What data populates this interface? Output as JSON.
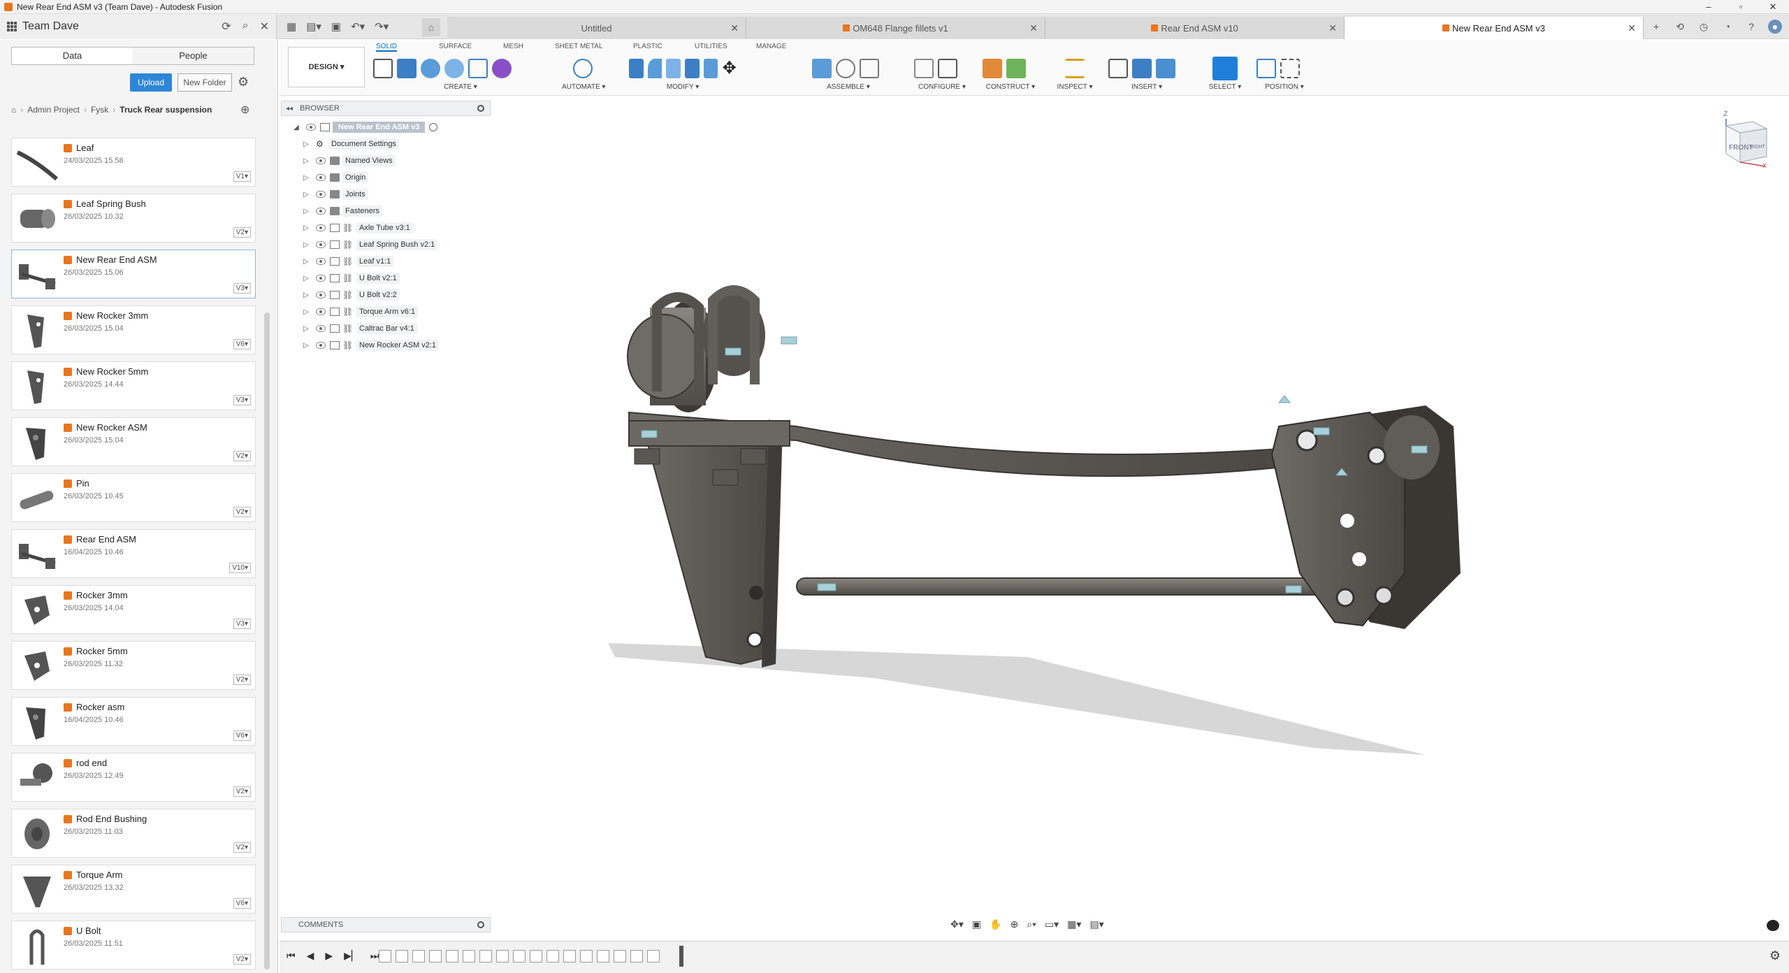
{
  "window": {
    "title": "New Rear End ASM v3 (Team Dave) - Autodesk Fusion",
    "minimize": "–",
    "maximize": "▫",
    "close": "✕"
  },
  "team": {
    "name": "Team Dave"
  },
  "tabs": [
    {
      "label": "Untitled",
      "active": false
    },
    {
      "label": "OM648 Flange fillets v1",
      "active": false
    },
    {
      "label": "Rear End ASM v10",
      "active": false
    },
    {
      "label": "New Rear End ASM v3",
      "active": true
    }
  ],
  "datapanel": {
    "tabs": [
      "Data",
      "People"
    ],
    "upload_label": "Upload",
    "new_folder_label": "New Folder",
    "breadcrumb": [
      "Admin Project",
      "Fysk",
      "Truck Rear suspension"
    ],
    "files": [
      {
        "name": "Leaf",
        "date": "24/03/2025 15.58",
        "version": "V1▾",
        "thumb": "leaf"
      },
      {
        "name": "Leaf Spring Bush",
        "date": "26/03/2025 10.32",
        "version": "V2▾",
        "thumb": "bush"
      },
      {
        "name": "New Rear End ASM",
        "date": "26/03/2025 15.06",
        "version": "V3▾",
        "thumb": "asm",
        "selected": true
      },
      {
        "name": "New Rocker 3mm",
        "date": "26/03/2025 15.04",
        "version": "V6▾",
        "thumb": "rocker"
      },
      {
        "name": "New Rocker 5mm",
        "date": "26/03/2025 14.44",
        "version": "V3▾",
        "thumb": "rocker"
      },
      {
        "name": "New Rocker ASM",
        "date": "26/03/2025 15.04",
        "version": "V2▾",
        "thumb": "rockerasm"
      },
      {
        "name": "Pin",
        "date": "26/03/2025 10.45",
        "version": "V2▾",
        "thumb": "pin"
      },
      {
        "name": "Rear End ASM",
        "date": "16/04/2025 10.46",
        "version": "V10▾",
        "thumb": "asm"
      },
      {
        "name": "Rocker 3mm",
        "date": "26/03/2025 14.04",
        "version": "V3▾",
        "thumb": "rocker2"
      },
      {
        "name": "Rocker 5mm",
        "date": "26/03/2025 11.32",
        "version": "V2▾",
        "thumb": "rocker2"
      },
      {
        "name": "Rocker asm",
        "date": "16/04/2025 10.46",
        "version": "V6▾",
        "thumb": "rockerasm"
      },
      {
        "name": "rod end",
        "date": "26/03/2025 12.49",
        "version": "V2▾",
        "thumb": "rodend"
      },
      {
        "name": "Rod End Bushing",
        "date": "26/03/2025 11.03",
        "version": "V2▾",
        "thumb": "bushing"
      },
      {
        "name": "Torque Arm",
        "date": "26/03/2025 13.32",
        "version": "V6▾",
        "thumb": "torque"
      },
      {
        "name": "U Bolt",
        "date": "26/03/2025 11.51",
        "version": "V2▾",
        "thumb": "ubolt"
      }
    ]
  },
  "toolbar": {
    "workspace": "DESIGN ▾",
    "tabs": [
      "SOLID",
      "SURFACE",
      "MESH",
      "SHEET METAL",
      "PLASTIC",
      "UTILITIES",
      "MANAGE"
    ],
    "groups": [
      "CREATE ▾",
      "AUTOMATE ▾",
      "MODIFY ▾",
      "ASSEMBLE ▾",
      "CONFIGURE ▾",
      "CONSTRUCT ▾",
      "INSPECT ▾",
      "INSERT ▾",
      "SELECT ▾",
      "POSITION ▾"
    ]
  },
  "browser": {
    "title": "BROWSER",
    "root": "New Rear End ASM v3",
    "items": [
      {
        "label": "Document Settings",
        "type": "settings"
      },
      {
        "label": "Named Views",
        "type": "folder"
      },
      {
        "label": "Origin",
        "type": "folder"
      },
      {
        "label": "Joints",
        "type": "folder"
      },
      {
        "label": "Fasteners",
        "type": "folder"
      },
      {
        "label": "Axle Tube v3:1",
        "type": "component"
      },
      {
        "label": "Leaf Spring Bush v2:1",
        "type": "component"
      },
      {
        "label": "Leaf v1:1",
        "type": "component"
      },
      {
        "label": "U Bolt v2:1",
        "type": "component"
      },
      {
        "label": "U Bolt v2:2",
        "type": "component"
      },
      {
        "label": "Torque Arm v6:1",
        "type": "component"
      },
      {
        "label": "Caltrac Bar v4:1",
        "type": "component"
      },
      {
        "label": "New Rocker ASM v2:1",
        "type": "component"
      }
    ]
  },
  "viewcube": {
    "face": "FRONT",
    "side": "RIGHT",
    "axis_z": "Z",
    "axis_x": "X"
  },
  "comments": {
    "title": "COMMENTS"
  },
  "colors": {
    "accent": "#0b6fc7",
    "brand": "#e8761f",
    "model": "#5e5a56"
  }
}
